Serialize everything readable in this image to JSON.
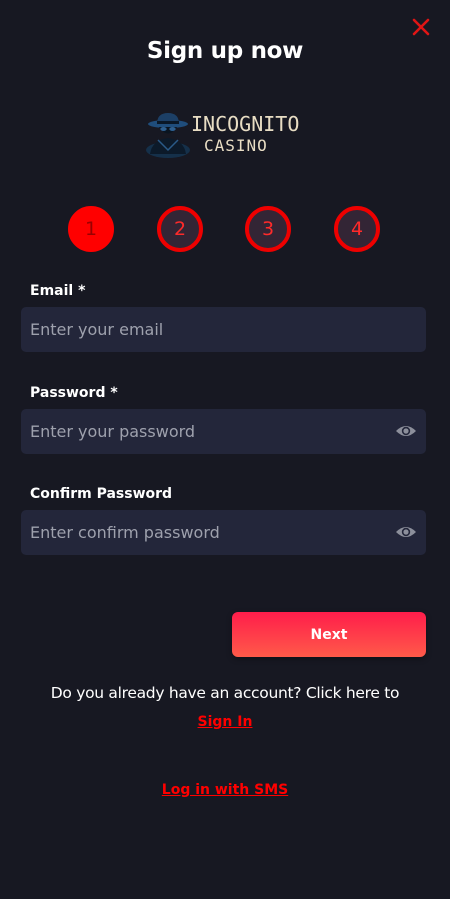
{
  "header": {
    "title": "Sign up now"
  },
  "logo": {
    "name": "INCOGNITO",
    "subtitle": "CASINO"
  },
  "steps": [
    {
      "label": "1",
      "state": "active"
    },
    {
      "label": "2",
      "state": "inactive"
    },
    {
      "label": "3",
      "state": "inactive"
    },
    {
      "label": "4",
      "state": "inactive"
    }
  ],
  "form": {
    "email": {
      "label": "Email *",
      "placeholder": "Enter your email",
      "value": ""
    },
    "password": {
      "label": "Password *",
      "placeholder": "Enter your password",
      "value": ""
    },
    "confirm_password": {
      "label": "Confirm Password",
      "placeholder": "Enter confirm password",
      "value": ""
    },
    "next_label": "Next"
  },
  "footer": {
    "account_prompt": "Do you already have an account? Click here to",
    "sign_in_label": "Sign In",
    "sms_label": "Log in with SMS"
  },
  "icons": {
    "close": "close-icon",
    "password_toggle": "eye-icon"
  },
  "colors": {
    "background": "#171822",
    "accent": "#ff0000",
    "input_bg": "#23263a",
    "button_gradient_start": "#ff1d4b",
    "button_gradient_end": "#ff5a49"
  }
}
